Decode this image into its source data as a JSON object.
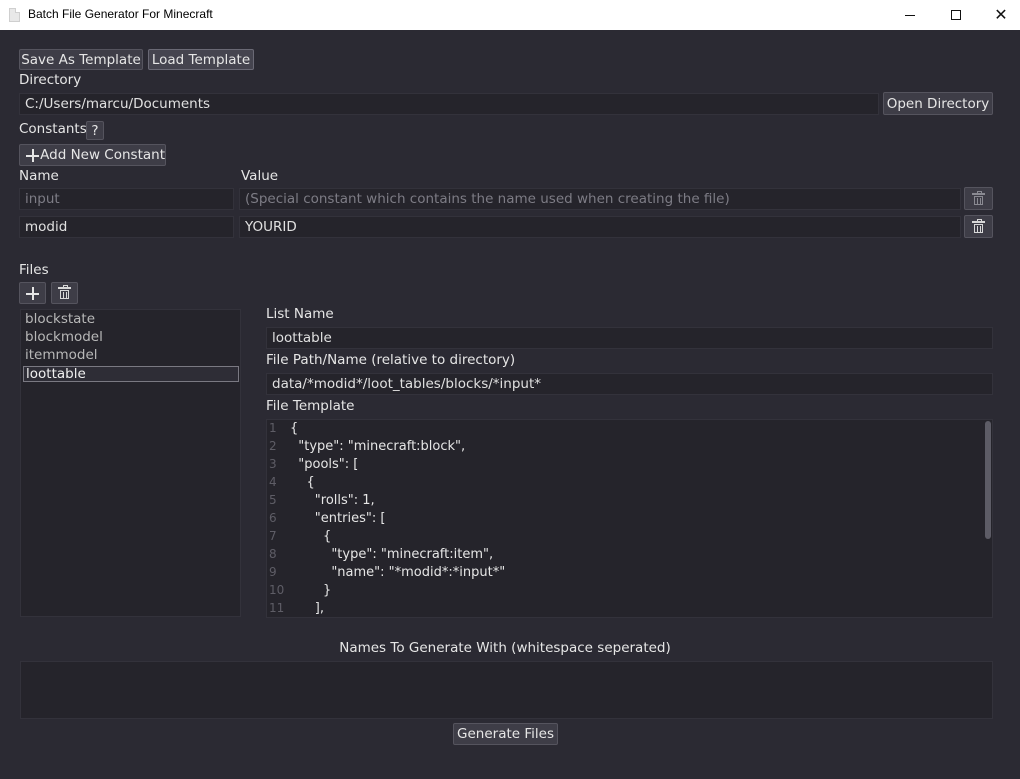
{
  "window": {
    "title": "Batch File Generator For Minecraft",
    "icon": "document-icon",
    "controls": {
      "minimize": "minimize",
      "maximize": "maximize",
      "close": "✕"
    }
  },
  "toolbar": {
    "save_template": "Save As Template",
    "load_template": "Load Template"
  },
  "directory": {
    "label": "Directory",
    "value": "C:/Users/marcu/Documents",
    "open_button": "Open Directory"
  },
  "constants": {
    "label": "Constants",
    "help_button": "?",
    "add_button": "Add New Constant",
    "name_header": "Name",
    "value_header": "Value",
    "rows": [
      {
        "name": "input",
        "value": "(Special constant which contains the name used when creating the file)",
        "disabled": true
      },
      {
        "name": "modid",
        "value": "YOURID",
        "disabled": false
      }
    ]
  },
  "files": {
    "label": "Files",
    "items": [
      "blockstate",
      "blockmodel",
      "itemmodel",
      "loottable"
    ],
    "selected": "loottable"
  },
  "detail": {
    "list_name_label": "List Name",
    "list_name_value": "loottable",
    "path_label": "File Path/Name (relative to directory)",
    "path_value": "data/*modid*/loot_tables/blocks/*input*",
    "template_label": "File Template",
    "template_lines": [
      {
        "n": "1",
        "text": "{"
      },
      {
        "n": "2",
        "text": "  \"type\": \"minecraft:block\","
      },
      {
        "n": "3",
        "text": "  \"pools\": ["
      },
      {
        "n": "4",
        "text": "    {"
      },
      {
        "n": "5",
        "text": "      \"rolls\": 1,"
      },
      {
        "n": "6",
        "text": "      \"entries\": ["
      },
      {
        "n": "7",
        "text": "        {"
      },
      {
        "n": "8",
        "text": "          \"type\": \"minecraft:item\","
      },
      {
        "n": "9",
        "text": "          \"name\": \"*modid*:*input*\""
      },
      {
        "n": "10",
        "text": "        }"
      },
      {
        "n": "11",
        "text": "      ],"
      }
    ]
  },
  "generate": {
    "names_label": "Names To Generate With (whitespace seperated)",
    "names_value": "",
    "generate_button": "Generate Files"
  },
  "colors": {
    "background": "#2b2a33",
    "field": "#25242b",
    "button": "#3e3d47"
  }
}
